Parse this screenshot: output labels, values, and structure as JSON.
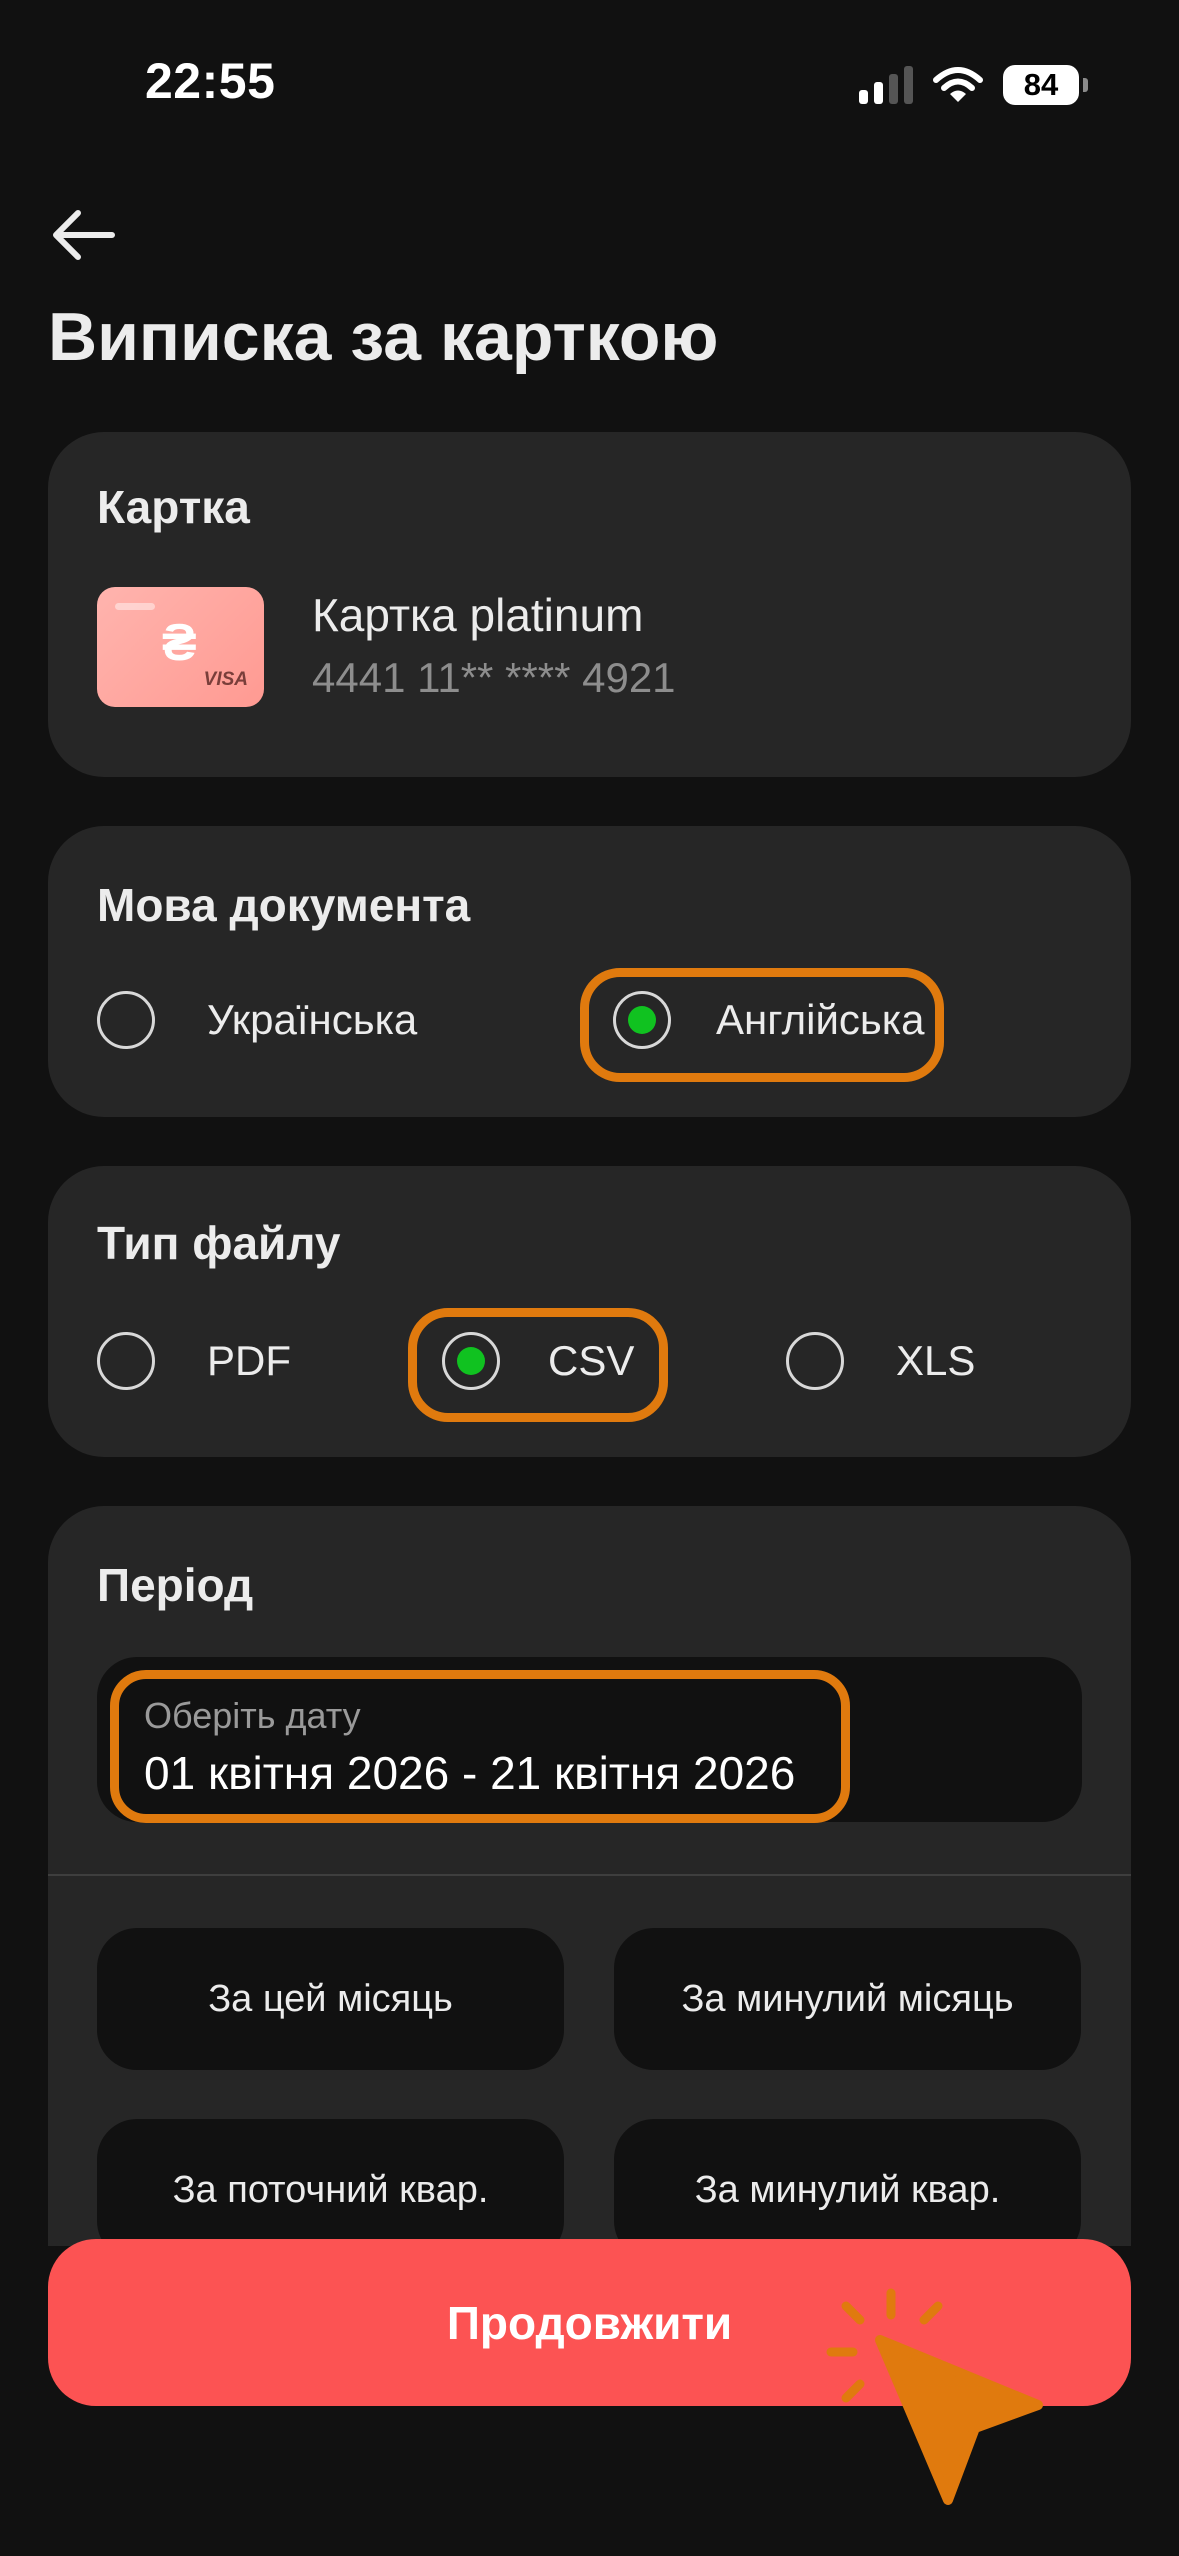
{
  "status_bar": {
    "time": "22:55",
    "battery": "84"
  },
  "header": {
    "title": "Виписка за карткою"
  },
  "card_section": {
    "title": "Картка",
    "card_name": "Картка platinum",
    "card_number": "4441 11** **** 4921",
    "currency_symbol": "₴",
    "brand": "VISA"
  },
  "language_section": {
    "title": "Мова документа",
    "options": [
      {
        "label": "Українська",
        "selected": false
      },
      {
        "label": "Англійська",
        "selected": true
      }
    ]
  },
  "file_type_section": {
    "title": "Тип файлу",
    "options": [
      {
        "label": "PDF",
        "selected": false
      },
      {
        "label": "CSV",
        "selected": true
      },
      {
        "label": "XLS",
        "selected": false
      }
    ]
  },
  "period_section": {
    "title": "Період",
    "date_label": "Оберіть дату",
    "date_value": "01 квітня 2026 - 21 квітня 2026",
    "presets": [
      "За цей місяць",
      "За минулий місяць",
      "За поточний квар.",
      "За минулий квар."
    ]
  },
  "continue_button": "Продовжити",
  "colors": {
    "background": "#111111",
    "card": "#262626",
    "accent": "#fc5353",
    "selected_dot": "#10c220",
    "highlight": "#e07a0e"
  }
}
